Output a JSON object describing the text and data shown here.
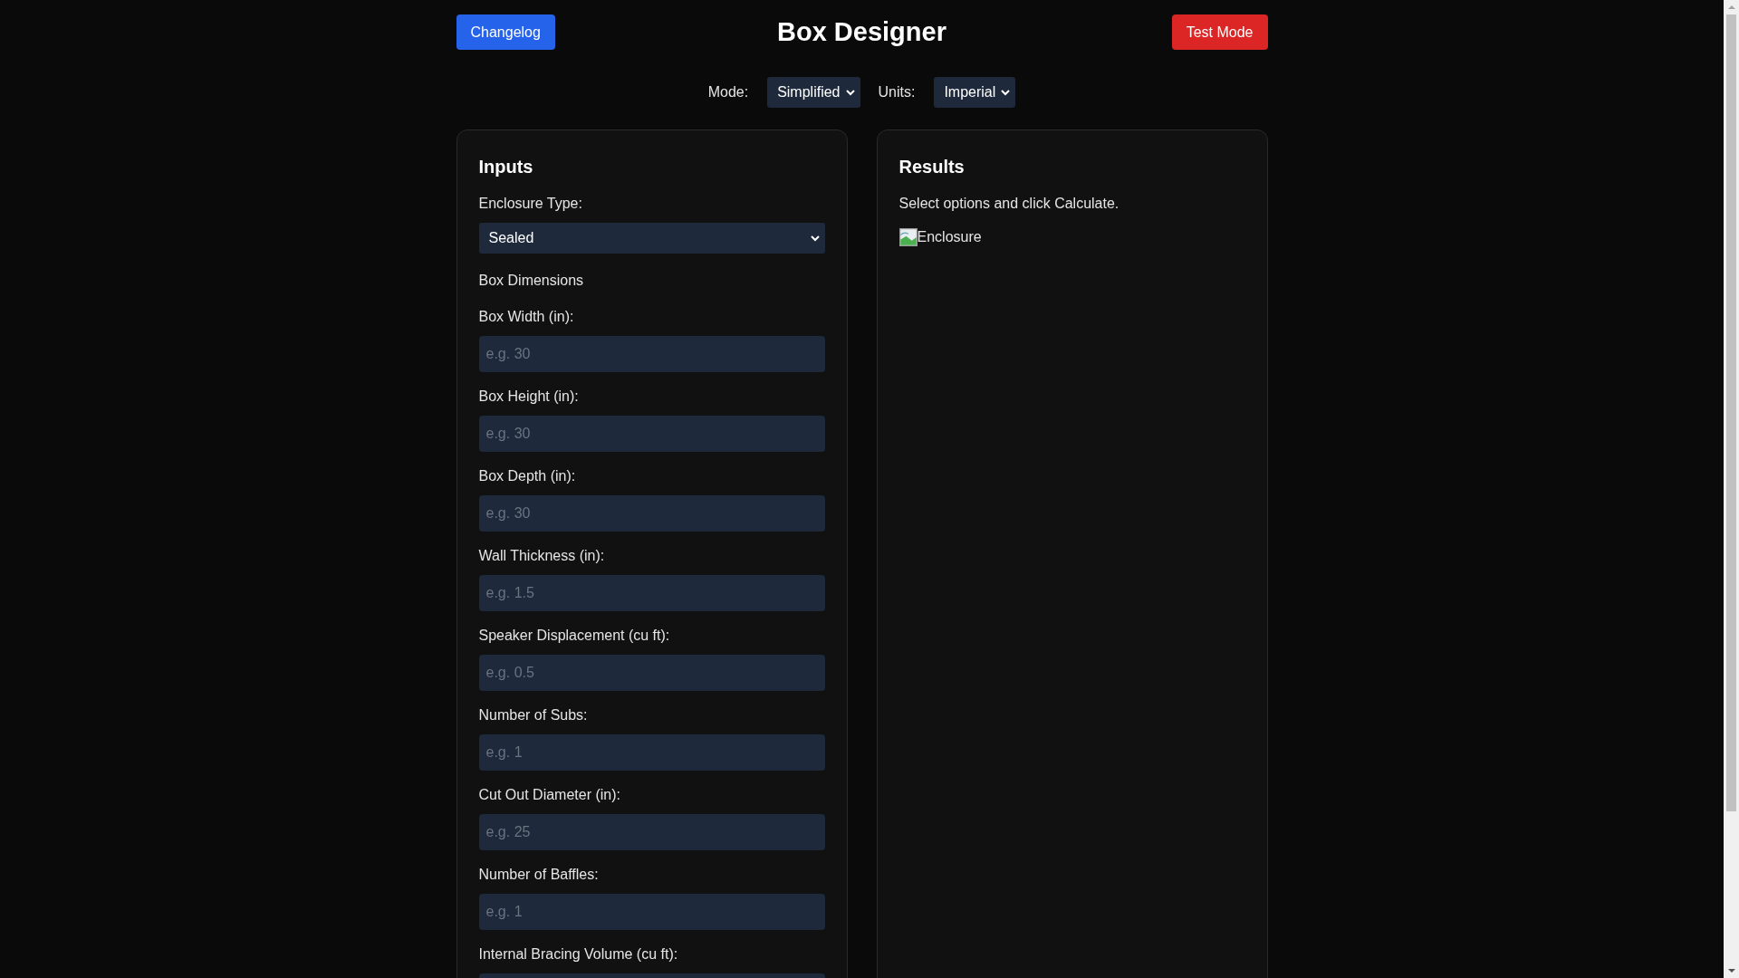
{
  "header": {
    "title": "Box Designer",
    "buttons": [
      {
        "label": "Changelog",
        "kind": "primary"
      },
      {
        "label": "Test Mode",
        "kind": "danger"
      }
    ]
  },
  "settings": [
    {
      "label": "Mode:",
      "value": "Simplified"
    },
    {
      "label": "Units:",
      "value": "Imperial"
    }
  ],
  "inputs": {
    "title": "Inputs",
    "items": [
      {
        "kind": "select",
        "label": "Enclosure Type:",
        "value": "Sealed"
      },
      {
        "kind": "heading",
        "label": "Box Dimensions"
      },
      {
        "kind": "number",
        "label": "Box Width (in):",
        "placeholder": "e.g. 30"
      },
      {
        "kind": "number",
        "label": "Box Height (in):",
        "placeholder": "e.g. 30"
      },
      {
        "kind": "number",
        "label": "Box Depth (in):",
        "placeholder": "e.g. 30"
      },
      {
        "kind": "number",
        "label": "Wall Thickness (in):",
        "placeholder": "e.g. 1.5"
      },
      {
        "kind": "number",
        "label": "Speaker Displacement (cu ft):",
        "placeholder": "e.g. 0.5"
      },
      {
        "kind": "number",
        "label": "Number of Subs:",
        "placeholder": "e.g. 1"
      },
      {
        "kind": "number",
        "label": "Cut Out Diameter (in):",
        "placeholder": "e.g. 25"
      },
      {
        "kind": "number",
        "label": "Number of Baffles:",
        "placeholder": "e.g. 1"
      },
      {
        "kind": "number",
        "label": "Internal Bracing Volume (cu ft):"
      }
    ]
  },
  "results": {
    "title": "Results",
    "message": "Select options and click Calculate.",
    "image_alt": "Enclosure"
  }
}
